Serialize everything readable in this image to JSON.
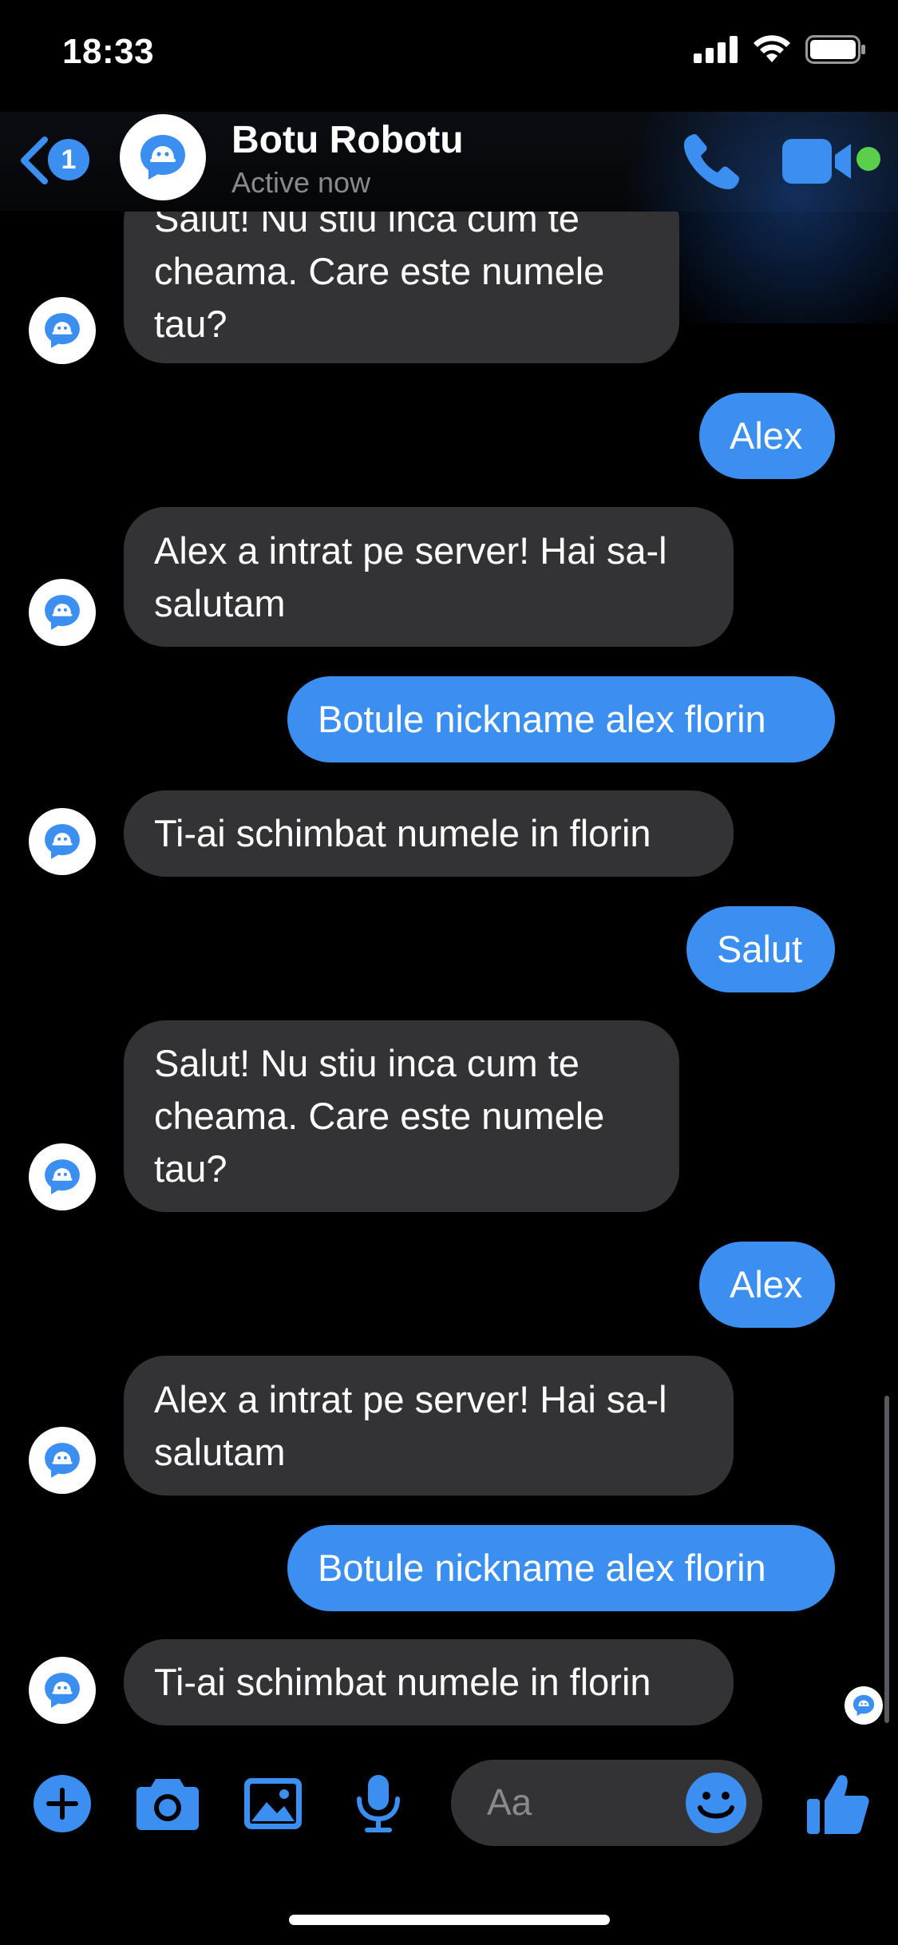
{
  "status_bar": {
    "time": "18:33"
  },
  "header": {
    "back_badge": "1",
    "contact_name": "Botu Robotu",
    "contact_status": "Active now",
    "icons": [
      "chevron-left-icon",
      "bot-avatar-icon",
      "phone-icon",
      "video-camera-icon"
    ],
    "accent_color": "#3a8ff0",
    "online_color": "#5ad04a"
  },
  "messages": [
    {
      "side": "in",
      "text": "Salut! Nu stiu inca cum te cheama. Care este numele tau?"
    },
    {
      "side": "out",
      "text": "Alex"
    },
    {
      "side": "in",
      "text": "Alex a intrat pe server! Hai sa-l salutam"
    },
    {
      "side": "out",
      "text": "Botule nickname alex florin"
    },
    {
      "side": "in",
      "text": "Ti-ai schimbat numele in florin"
    },
    {
      "side": "out",
      "text": "Salut"
    },
    {
      "side": "in",
      "text": "Salut! Nu stiu inca cum te cheama. Care este numele tau?"
    },
    {
      "side": "out",
      "text": "Alex"
    },
    {
      "side": "in",
      "text": "Alex a intrat pe server! Hai sa-l salutam"
    },
    {
      "side": "out",
      "text": "Botule nickname alex florin"
    },
    {
      "side": "in",
      "text": "Ti-ai schimbat numele in florin"
    }
  ],
  "composer": {
    "placeholder": "Aa",
    "icons": [
      "plus-icon",
      "camera-icon",
      "image-icon",
      "microphone-icon",
      "emoji-icon",
      "thumbs-up-icon"
    ]
  }
}
